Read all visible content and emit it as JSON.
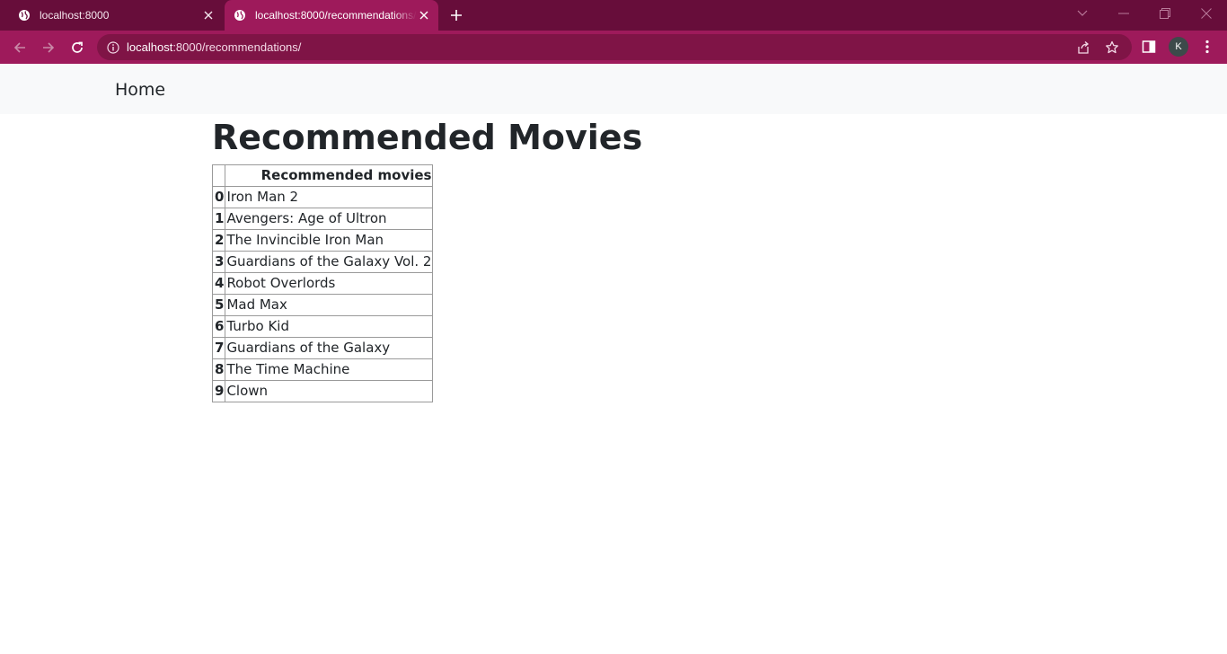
{
  "browser": {
    "tabs": [
      {
        "title": "localhost:8000",
        "active": false
      },
      {
        "title": "localhost:8000/recommendations/",
        "active": true
      }
    ],
    "address_bar": {
      "host": "localhost",
      "rest": ":8000/recommendations/"
    },
    "profile_initial": "K",
    "colors": {
      "tabstrip": "#670d3a",
      "toolbar": "#9e1a5b",
      "omnibox": "#7f1446"
    }
  },
  "navbar": {
    "brand": "Home"
  },
  "main": {
    "heading": "Recommended Movies",
    "table": {
      "index_header": "",
      "column_header": "Recommended movies",
      "rows": [
        {
          "index": "0",
          "movie": "Iron Man 2"
        },
        {
          "index": "1",
          "movie": "Avengers: Age of Ultron"
        },
        {
          "index": "2",
          "movie": "The Invincible Iron Man"
        },
        {
          "index": "3",
          "movie": "Guardians of the Galaxy Vol. 2"
        },
        {
          "index": "4",
          "movie": "Robot Overlords"
        },
        {
          "index": "5",
          "movie": "Mad Max"
        },
        {
          "index": "6",
          "movie": "Turbo Kid"
        },
        {
          "index": "7",
          "movie": "Guardians of the Galaxy"
        },
        {
          "index": "8",
          "movie": "The Time Machine"
        },
        {
          "index": "9",
          "movie": "Clown"
        }
      ]
    }
  }
}
